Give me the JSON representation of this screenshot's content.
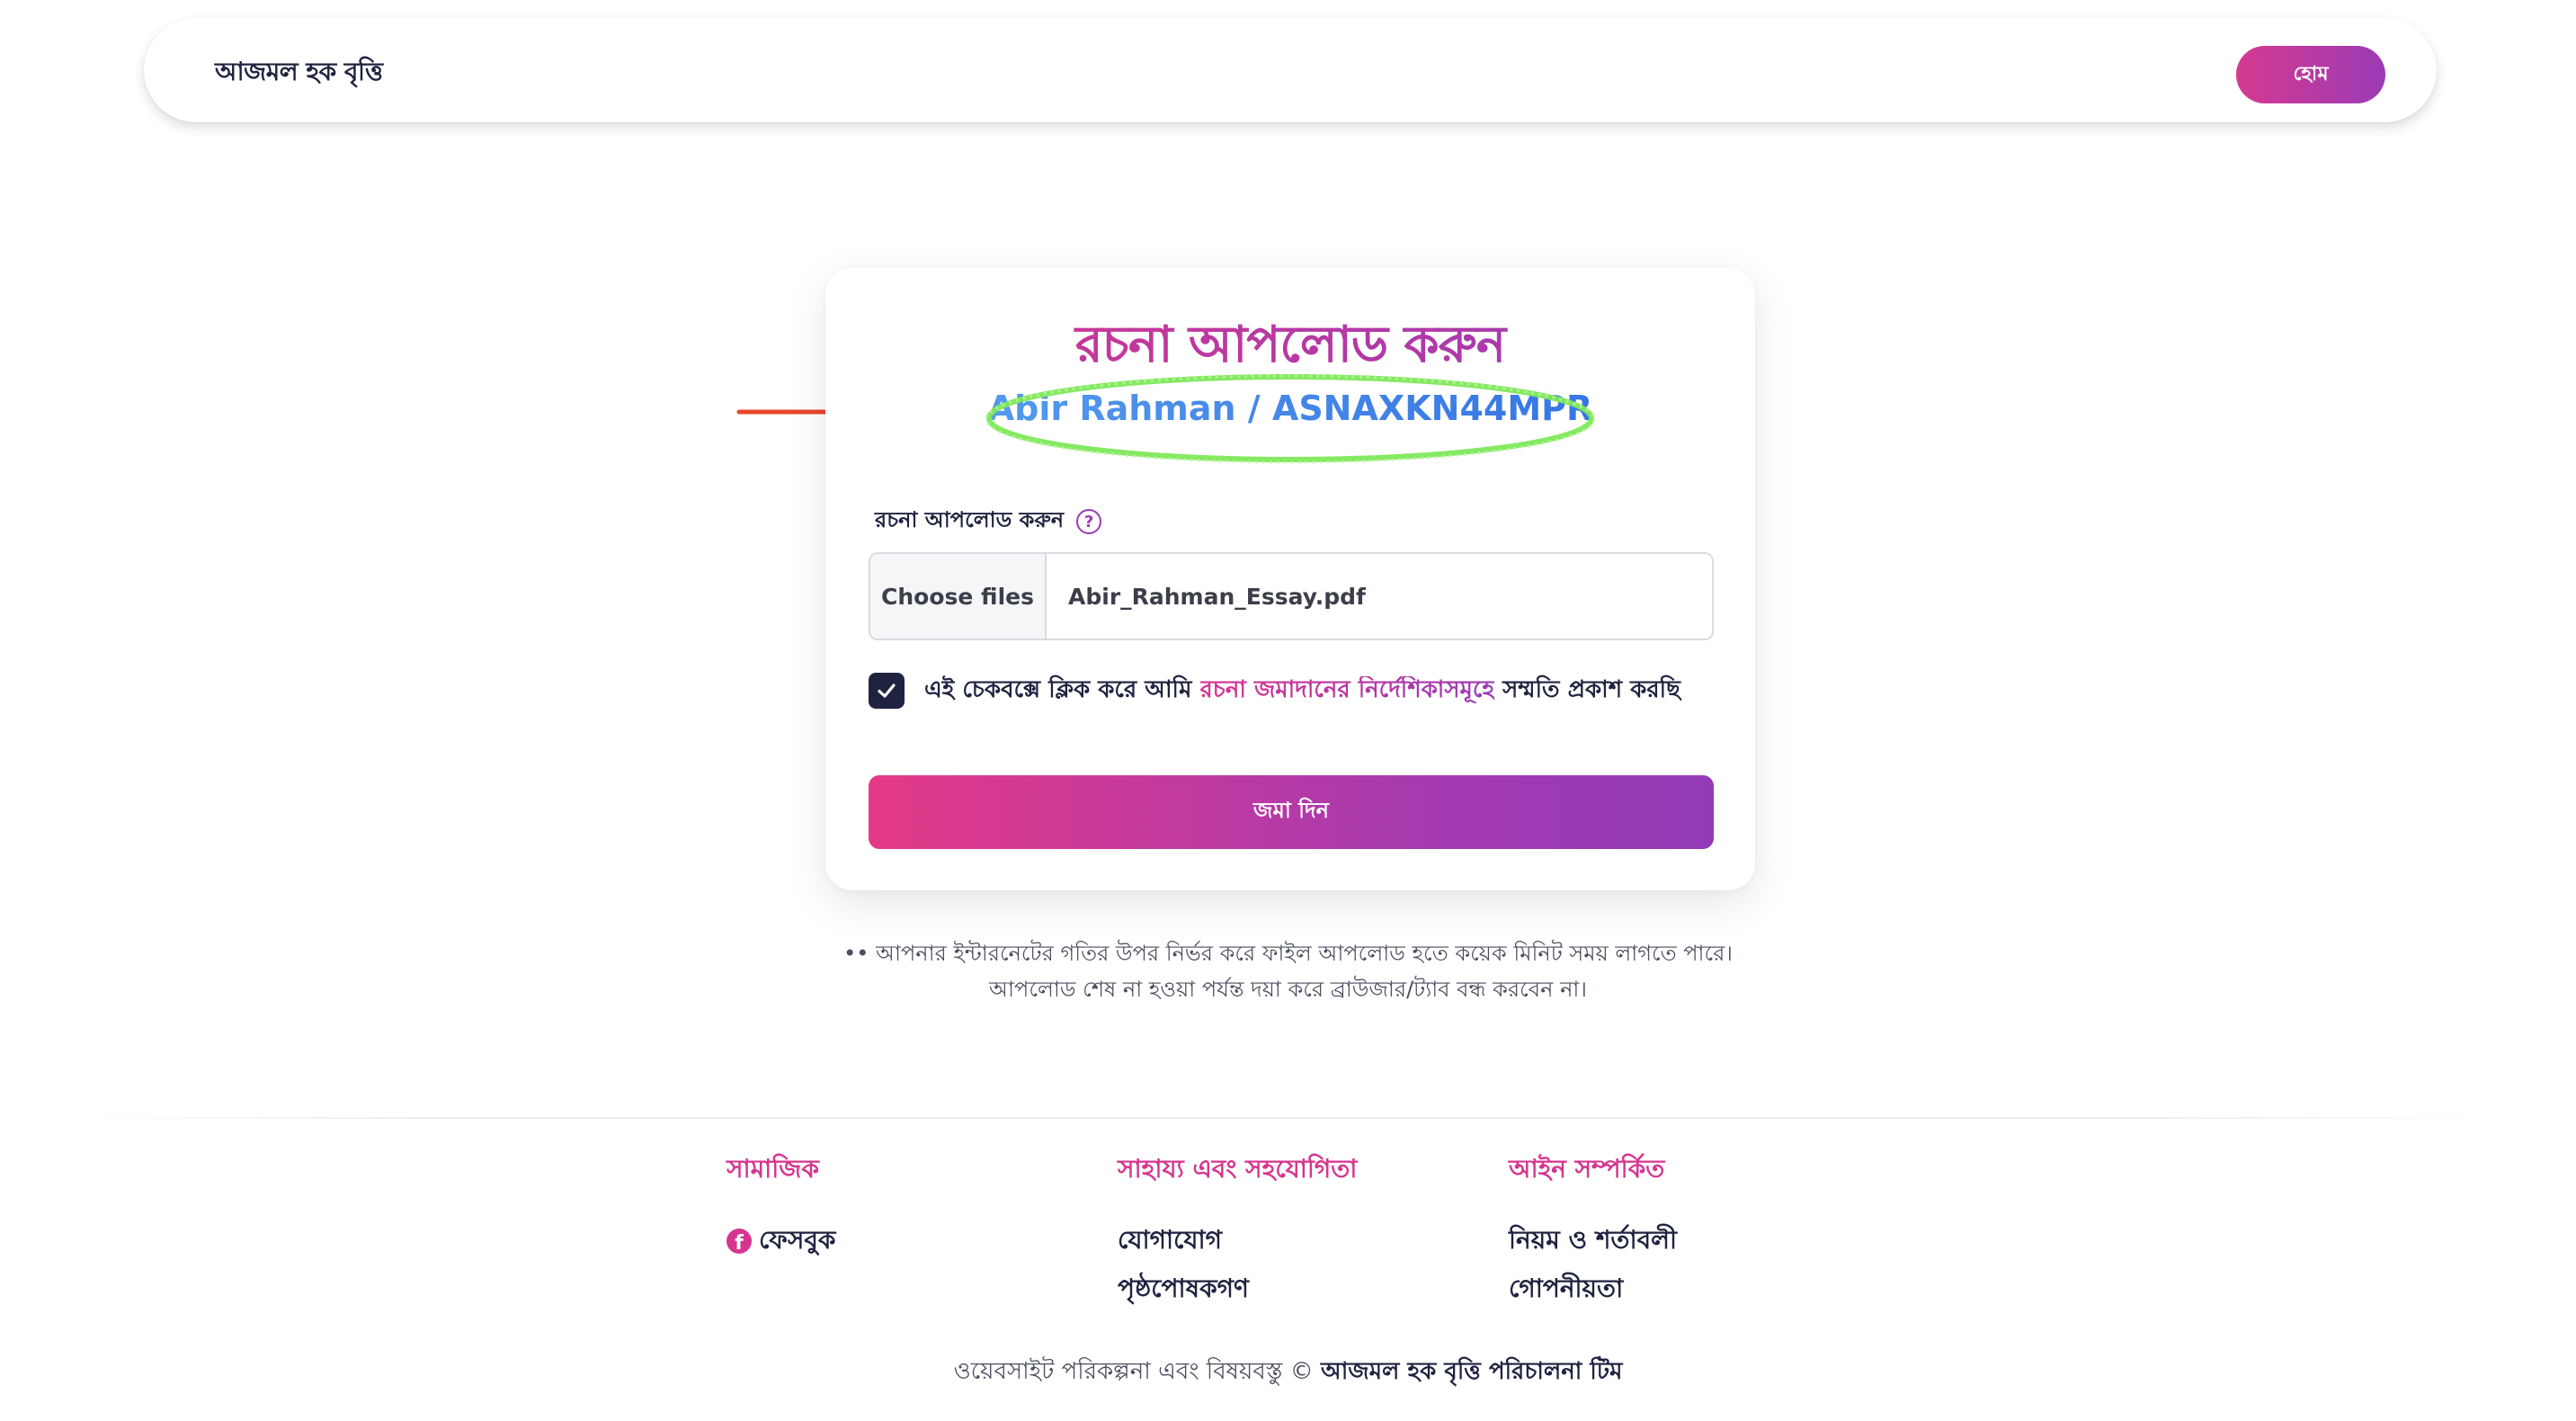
{
  "header": {
    "brand": "আজমল হক বৃত্তি",
    "home_label": "হোম"
  },
  "card": {
    "title": "রচনা আপলোড করুন",
    "identity": "Abir Rahman / ASNAXKN44MPR",
    "field_label": "রচনা আপলোড করুন",
    "help_icon": "?",
    "file_input": {
      "button_label": "Choose files",
      "file_name": "Abir_Rahman_Essay.pdf"
    },
    "consent": {
      "checked": true,
      "prefix": "এই চেকবক্সে ক্লিক করে আমি",
      "link_text": "রচনা জমাদানের নির্দেশিকাসমূহে",
      "suffix": "সম্মতি প্রকাশ করছি"
    },
    "submit_label": "জমা দিন"
  },
  "notes": {
    "line1": "•• আপনার ইন্টারনেটের গতির উপর নির্ভর করে ফাইল আপলোড হতে কয়েক মিনিট সময় লাগতে পারে।",
    "line2": "আপলোড শেষ না হওয়া পর্যন্ত দয়া করে ব্রাউজার/ট্যাব বন্ধ করবেন না।"
  },
  "footer": {
    "columns": [
      {
        "heading": "সামাজিক",
        "items": [
          "ফেসবুক"
        ]
      },
      {
        "heading": "সাহায্য এবং সহযোগিতা",
        "items": [
          "যোগাযোগ",
          "পৃষ্ঠপোষকগণ"
        ]
      },
      {
        "heading": "আইন সম্পর্কিত",
        "items": [
          "নিয়ম ও শর্তাবলী",
          "গোপনীয়তা"
        ]
      }
    ],
    "copyright_prefix": "ওয়েবসাইট পরিকল্পনা এবং বিষয়বস্তু ©",
    "copyright_owner": "আজমল হক বৃত্তি পরিচালনা টিম"
  },
  "icons": {
    "help": "question-circle-icon",
    "check": "check-icon",
    "facebook": "facebook-icon",
    "annotation_arrow": "arrow-right-icon"
  },
  "colors": {
    "accent_pink": "#d6358f",
    "accent_purple": "#9a3bb6",
    "identity_blue": "#3a7fe6",
    "annotation_red": "#e8472b",
    "annotation_green": "#7ee85a",
    "text_dark": "#1f2340"
  }
}
